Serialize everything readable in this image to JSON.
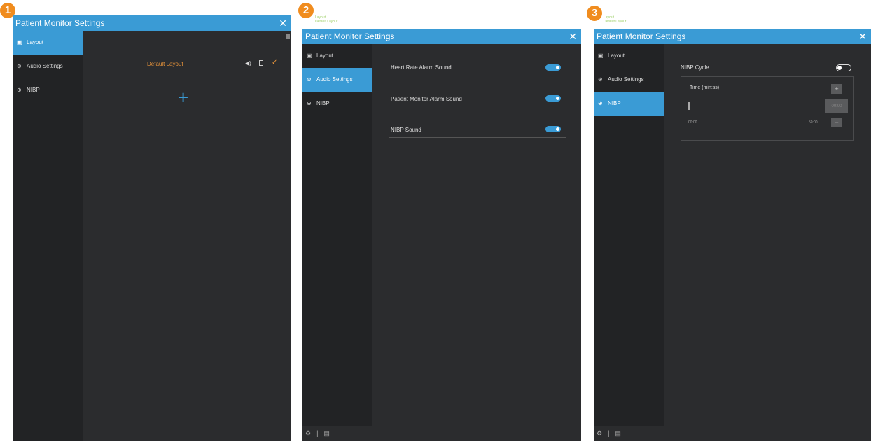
{
  "window_title": "Patient Monitor Settings",
  "close_glyph": "✕",
  "sidebar_items": [
    {
      "label": "Layout",
      "icon": "layout-icon"
    },
    {
      "label": "Audio Settings",
      "icon": "audio-settings-icon"
    },
    {
      "label": "NIBP",
      "icon": "nibp-icon"
    }
  ],
  "top_notes": [
    "Layout",
    "Default Layout"
  ],
  "panels": [
    {
      "badge": "1",
      "active_item": 0
    },
    {
      "badge": "2",
      "active_item": 1
    },
    {
      "badge": "3",
      "active_item": 2
    }
  ],
  "layout_page": {
    "layout_name": "Default Layout",
    "add_glyph": "+",
    "actions": [
      "speaker-icon",
      "delete-icon",
      "check-icon"
    ]
  },
  "audio_page": {
    "settings": [
      {
        "label": "Heart Rate Alarm Sound",
        "enabled": true
      },
      {
        "label": "Patient Monitor Alarm Sound",
        "enabled": true
      },
      {
        "label": "NIBP Sound",
        "enabled": true
      }
    ]
  },
  "nibp_page": {
    "cycle_label": "NIBP Cycle",
    "cycle_enabled": false,
    "time_label": "Time (min:ss)",
    "slider_min": "00:00",
    "slider_max": "59:00",
    "current_value": "00:00",
    "plus": "+",
    "minus": "−"
  },
  "colors": {
    "accent": "#3a9bd5",
    "layout_name": "#e8943a",
    "badge": "#f08c1e"
  }
}
